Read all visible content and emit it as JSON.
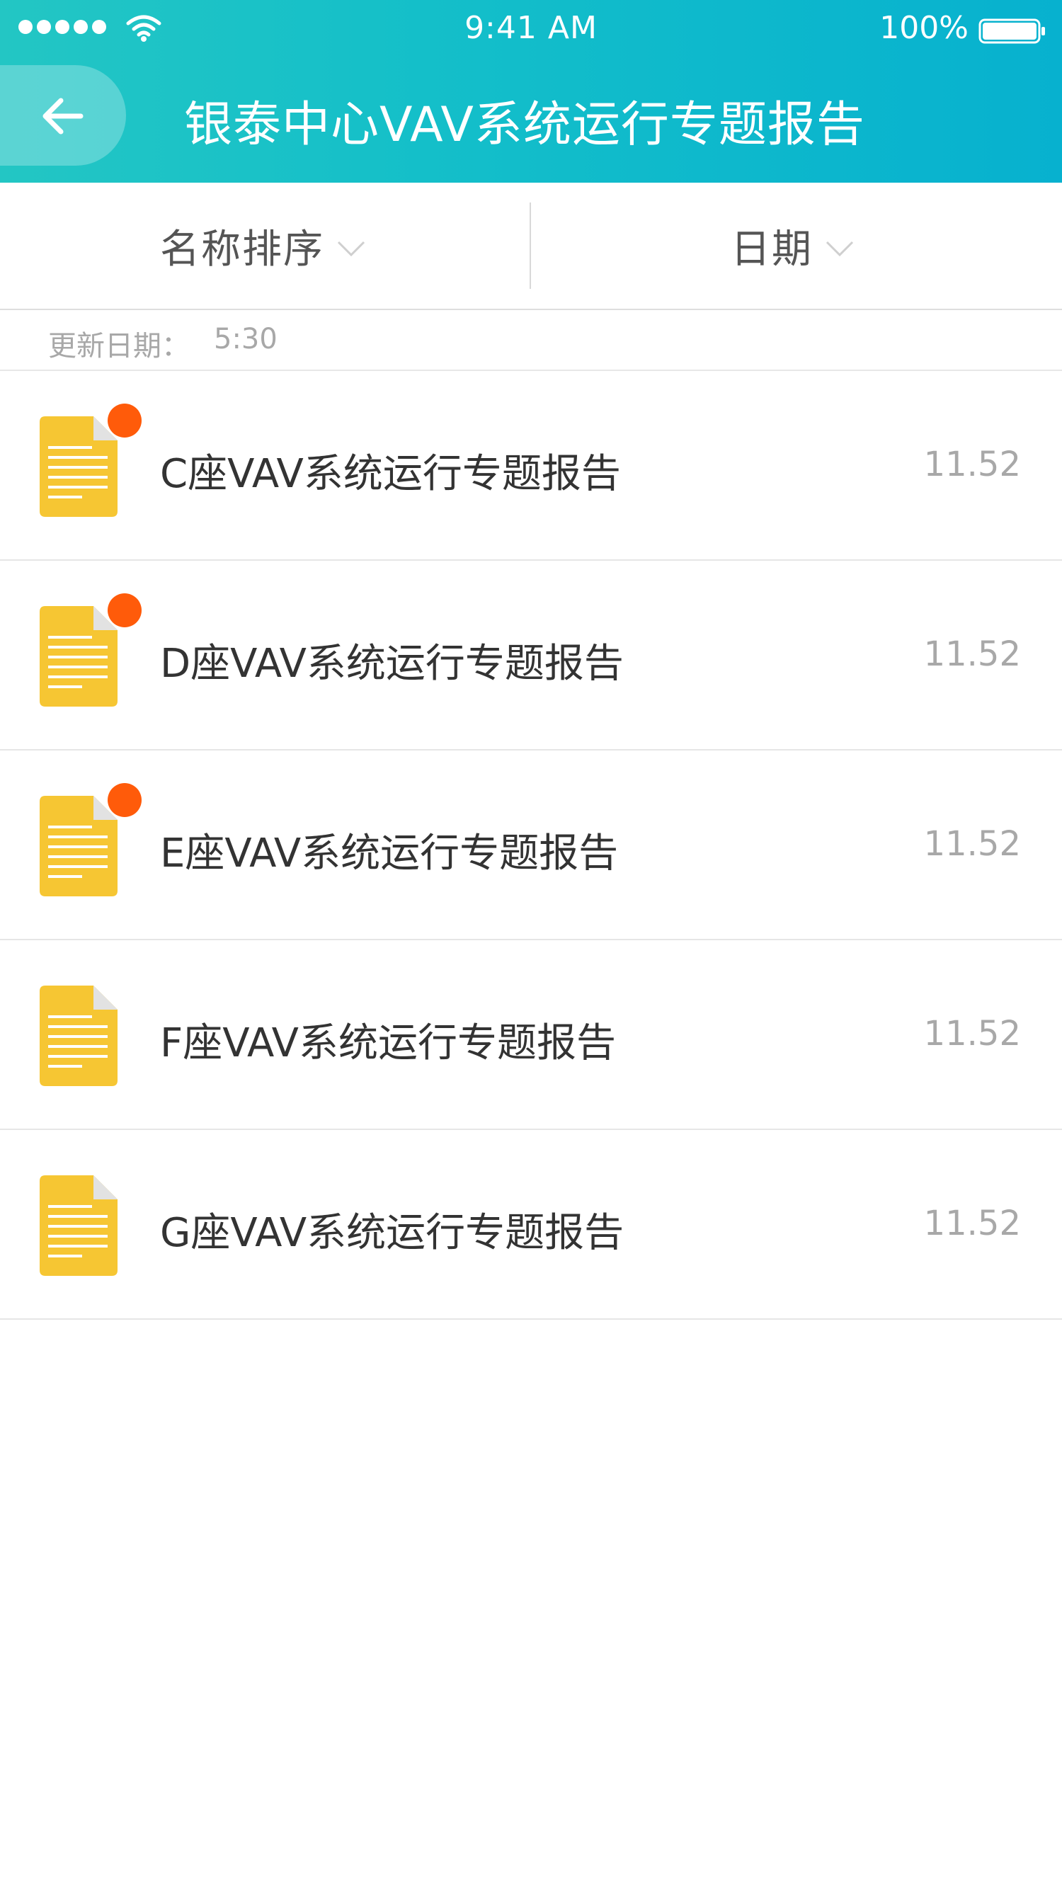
{
  "status_bar": {
    "time": "9:41 AM",
    "battery": "100%",
    "signal_icon": "signal-dots-icon",
    "wifi_icon": "wifi-icon",
    "battery_icon": "battery-icon"
  },
  "header": {
    "title": "银泰中心VAV系统运行专题报告",
    "back_icon": "arrow-left-icon",
    "gradient_colors": [
      "#23c6c4",
      "#07b1cf"
    ]
  },
  "filters": {
    "sort_label": "名称排序",
    "date_label": "日期",
    "dropdown_icon": "chevron-down-icon"
  },
  "update": {
    "label": "更新日期：",
    "time": "5:30"
  },
  "reports": [
    {
      "title": "C座VAV系统运行专题报告",
      "size": "11.52",
      "unread": true
    },
    {
      "title": "D座VAV系统运行专题报告",
      "size": "11.52",
      "unread": true
    },
    {
      "title": "E座VAV系统运行专题报告",
      "size": "11.52",
      "unread": true
    },
    {
      "title": "F座VAV系统运行专题报告",
      "size": "11.52",
      "unread": false
    },
    {
      "title": "G座VAV系统运行专题报告",
      "size": "11.52",
      "unread": false
    }
  ],
  "colors": {
    "unread_dot": "#ff5b0a",
    "doc_icon": "#f6c633"
  }
}
